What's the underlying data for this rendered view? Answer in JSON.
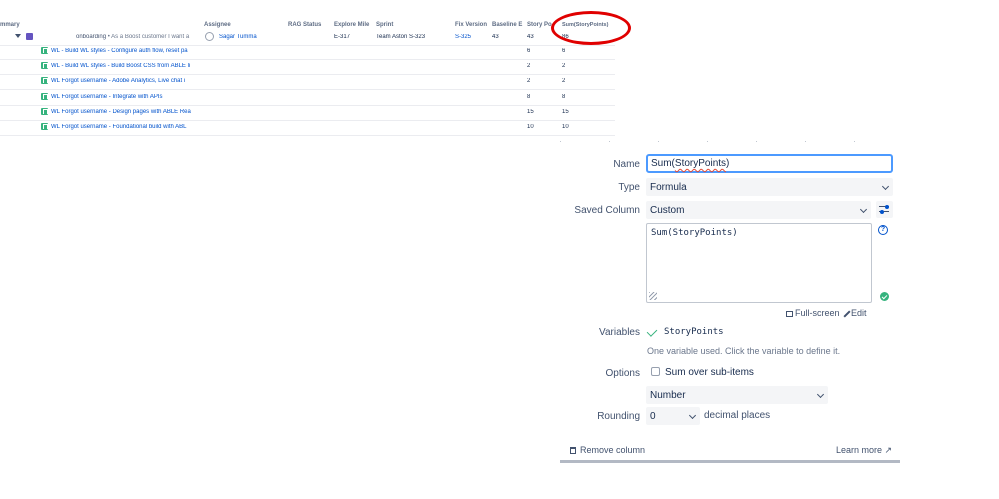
{
  "table": {
    "headers": {
      "summary": "mmary",
      "assignee": "Assignee",
      "rag_status": "RAG Status",
      "explore_milestone": "Explore Mile",
      "sprint": "Sprint",
      "fix_version": "Fix Version",
      "baseline": "Baseline E",
      "story_points": "Story Po",
      "sum_story_points": "Sum(StoryPoints)"
    },
    "epic_row": {
      "summary_prefix": "onboarding",
      "summary_rest": "• As a Boost customer I want a",
      "assignee": "Sagar Tumma",
      "explore_milestone": "E-317",
      "sprint": "Team Aston S-323",
      "fix_version": "S-325",
      "baseline": "43",
      "story_points": "43",
      "sum_story_points": "86"
    },
    "rows": [
      {
        "summary": "WL - Build WL styles - Configure auth flow, reset pa",
        "story_points": "6",
        "sum_story_points": "6"
      },
      {
        "summary": "WL - Build WL styles - Build Boost CSS from ABLE li",
        "story_points": "2",
        "sum_story_points": "2"
      },
      {
        "summary": "WL Forgot username - Adobe Analytics, Live chat i",
        "story_points": "2",
        "sum_story_points": "2"
      },
      {
        "summary": "WL Forgot username - Integrate with APIs",
        "story_points": "8",
        "sum_story_points": "8"
      },
      {
        "summary": "WL Forgot username - Design pages with ABLE Rea",
        "story_points": "15",
        "sum_story_points": "15"
      },
      {
        "summary": "WL Forgot username - Foundational build with ABL",
        "story_points": "10",
        "sum_story_points": "10"
      }
    ]
  },
  "panel": {
    "name_label": "Name",
    "name_value_prefix": "Sum(",
    "name_value_squiggle": "StoryPoints",
    "name_value_suffix": ")",
    "type_label": "Type",
    "type_value": "Formula",
    "saved_column_label": "Saved Column",
    "saved_column_value": "Custom",
    "formula": "Sum(StoryPoints)",
    "fullscreen_label": "Full-screen",
    "edit_label": "Edit",
    "variables_label": "Variables",
    "variable_name": "StoryPoints",
    "variables_hint": "One variable used. Click the variable to define it.",
    "options_label": "Options",
    "sum_over_subitems_label": "Sum over sub-items",
    "format_value": "Number",
    "rounding_label": "Rounding",
    "rounding_value": "0",
    "decimal_places_label": "decimal places",
    "remove_column_label": "Remove column",
    "learn_more_label": "Learn more ↗"
  },
  "colors": {
    "link": "#0052cc",
    "annotation": "#e00000",
    "success": "#36b37e",
    "focus": "#4c9aff"
  }
}
